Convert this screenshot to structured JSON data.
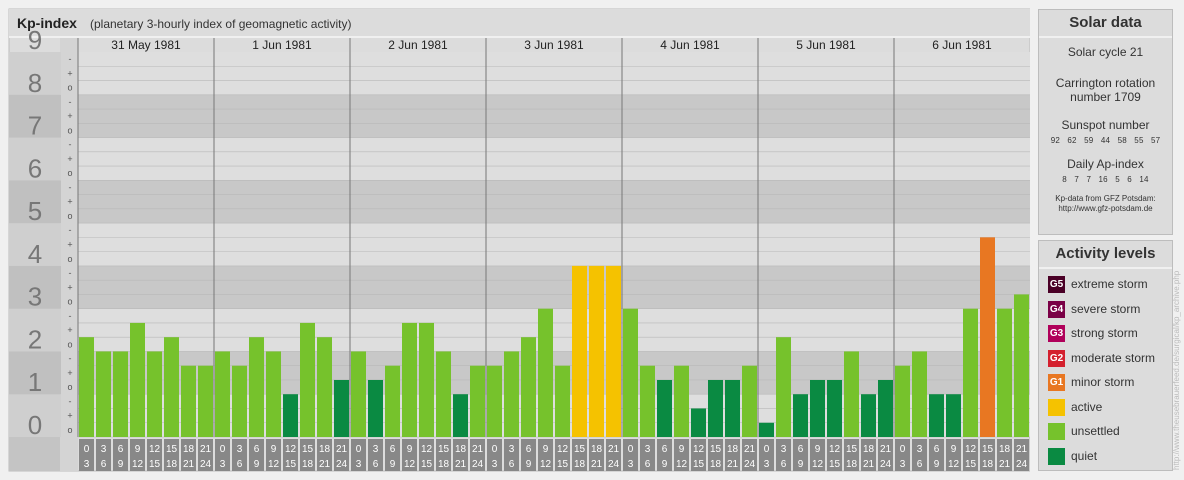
{
  "header": {
    "title": "Kp-index",
    "subtitle": "(planetary 3-hourly index of geomagnetic activity)"
  },
  "chart_data": {
    "type": "bar",
    "title": "Kp-index",
    "subtitle": "(planetary 3-hourly index of geomagnetic activity)",
    "ylim": [
      0,
      9
    ],
    "y_ticks": [
      "0",
      "1",
      "2",
      "3",
      "4",
      "5",
      "6",
      "7",
      "8",
      "9"
    ],
    "minor_ticks": [
      "o",
      "+",
      "-"
    ],
    "days": [
      "31 May 1981",
      "1 Jun 1981",
      "2 Jun 1981",
      "3 Jun 1981",
      "4 Jun 1981",
      "5 Jun 1981",
      "6 Jun 1981"
    ],
    "interval_start": [
      "0",
      "3",
      "6",
      "9",
      "12",
      "15",
      "18",
      "21"
    ],
    "interval_end": [
      "3",
      "6",
      "9",
      "12",
      "15",
      "18",
      "21",
      "24"
    ],
    "values": [
      [
        2.333,
        2.0,
        2.0,
        2.667,
        2.0,
        2.333,
        1.667,
        1.667
      ],
      [
        2.0,
        1.667,
        2.333,
        2.0,
        1.0,
        2.667,
        2.333,
        1.333
      ],
      [
        2.0,
        1.333,
        1.667,
        2.667,
        2.667,
        2.0,
        1.0,
        1.667
      ],
      [
        1.667,
        2.0,
        2.333,
        3.0,
        1.667,
        4.0,
        4.0,
        4.0
      ],
      [
        3.0,
        1.667,
        1.333,
        1.667,
        0.667,
        1.333,
        1.333,
        1.667
      ],
      [
        0.333,
        2.333,
        1.0,
        1.333,
        1.333,
        2.0,
        1.0,
        1.333
      ],
      [
        1.667,
        2.0,
        1.0,
        1.0,
        3.0,
        4.667,
        3.0,
        3.333
      ]
    ],
    "last_value": 2.667,
    "grid": true,
    "legend_position": "right"
  },
  "solar": {
    "title": "Solar data",
    "cycle": "Solar cycle 21",
    "carrington_1": "Carrington rotation",
    "carrington_2": "number 1709",
    "sunspot_label": "Sunspot number",
    "sunspot_values": "92 62 59 44 58 55 57",
    "ap_label": "Daily Ap-index",
    "ap_values": "8 7 7 16 5 6 14",
    "credit_1": "Kp-data from GFZ Potsdam:",
    "credit_2": "http://www.gfz-potsdam.de"
  },
  "legend": {
    "title": "Activity levels",
    "items": [
      {
        "code": "G5",
        "label": "extreme storm",
        "color": "#4a0026"
      },
      {
        "code": "G4",
        "label": "severe storm",
        "color": "#7a0046"
      },
      {
        "code": "G3",
        "label": "strong storm",
        "color": "#b0005a"
      },
      {
        "code": "G2",
        "label": "moderate storm",
        "color": "#d4202e"
      },
      {
        "code": "G1",
        "label": "minor storm",
        "color": "#e87722"
      },
      {
        "code": "",
        "label": "active",
        "color": "#f5c200"
      },
      {
        "code": "",
        "label": "unsettled",
        "color": "#76c22c"
      },
      {
        "code": "",
        "label": "quiet",
        "color": "#0a8a42"
      }
    ]
  },
  "side_credit": "http://www.theusebrauerfeed.de/surgical/kp_archive.php"
}
